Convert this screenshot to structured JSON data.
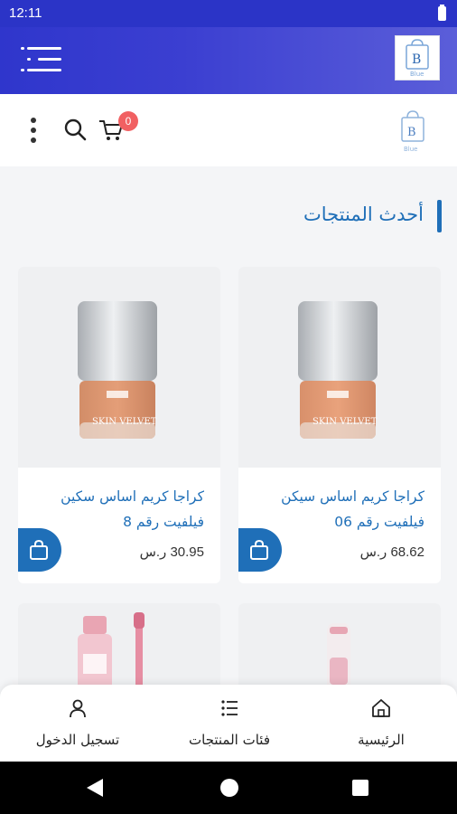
{
  "status_bar": {
    "time": "12:11"
  },
  "app_bar": {
    "logo_text": "Blue"
  },
  "toolbar": {
    "cart_count": "0"
  },
  "section": {
    "title": "أحدث المنتجات"
  },
  "products": [
    {
      "name": "كراجا كريم اساس سيكن فيلفيت رقم 06",
      "price": "68.62 ر.س",
      "image_label": "SKIN VELVET"
    },
    {
      "name": "كراجا كريم اساس سكين فيلفيت رقم 8",
      "price": "30.95 ر.س",
      "image_label": "SKIN VELVET"
    }
  ],
  "bottom_nav": {
    "home": "الرئيسية",
    "categories": "فئات المنتجات",
    "login": "تسجيل الدخول"
  },
  "colors": {
    "primary": "#2f36cc",
    "accent": "#1f6fb8",
    "badge": "#f16062"
  }
}
